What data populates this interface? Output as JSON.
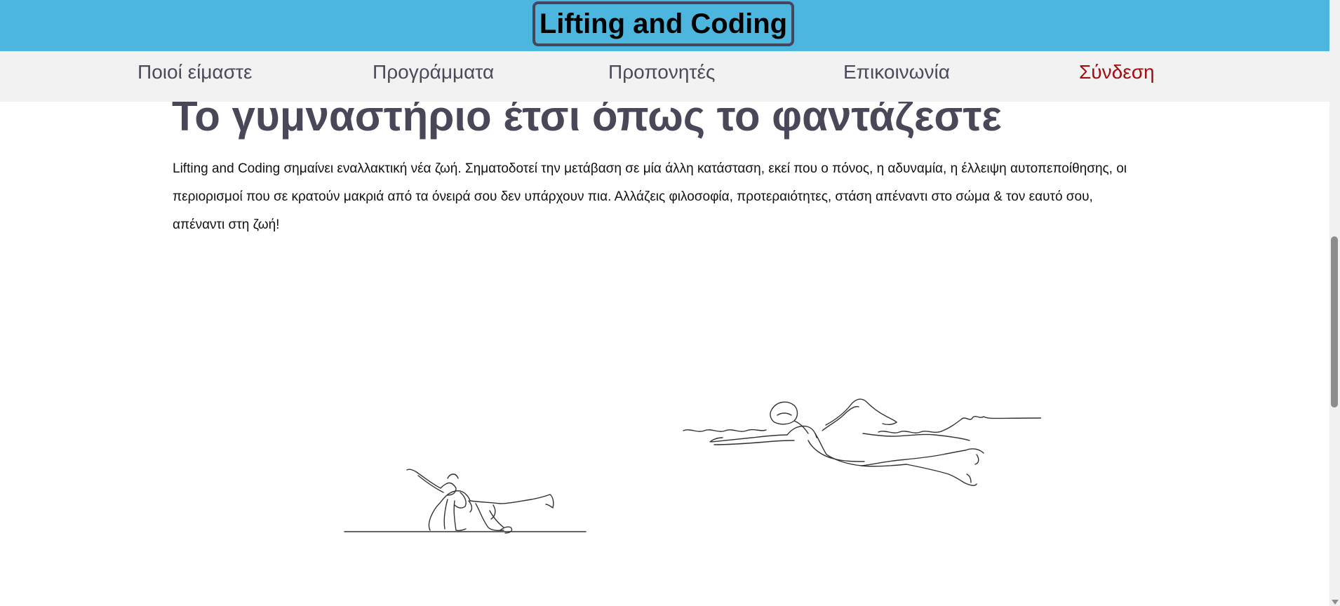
{
  "header": {
    "brand": "Lifting and Coding",
    "background": "#4cb6de"
  },
  "nav": {
    "items": [
      {
        "label": "Ποιοί είμαστε"
      },
      {
        "label": "Προγράμματα"
      },
      {
        "label": "Προπονητές"
      },
      {
        "label": "Επικοινωνία"
      },
      {
        "label": "Σύνδεση"
      }
    ],
    "login_color": "#a00d12"
  },
  "main": {
    "heading": "Το γυμναστήριο έτσι όπως το φαντάζεστε",
    "intro": "Lifting and Coding σημαίνει εναλλακτική νέα ζωή. Σηματοδοτεί την μετάβαση σε μία άλλη κατάσταση, εκεί που ο πόνος, η αδυναμία, η έλλειψη αυτοπεποίθησης, οι περιορισμοί που σε κρατούν μακριά από τα όνειρά σου δεν υπάρχουν πια. Αλλάζεις φιλοσοφία, προτεραιότητες, στάση απέναντι στο σώμα & τον εαυτό σου, απέναντι στη ζωή!",
    "illustrations": [
      {
        "icon": "yoga-bird-dog-illustration"
      },
      {
        "icon": "swimmer-illustration"
      }
    ]
  }
}
